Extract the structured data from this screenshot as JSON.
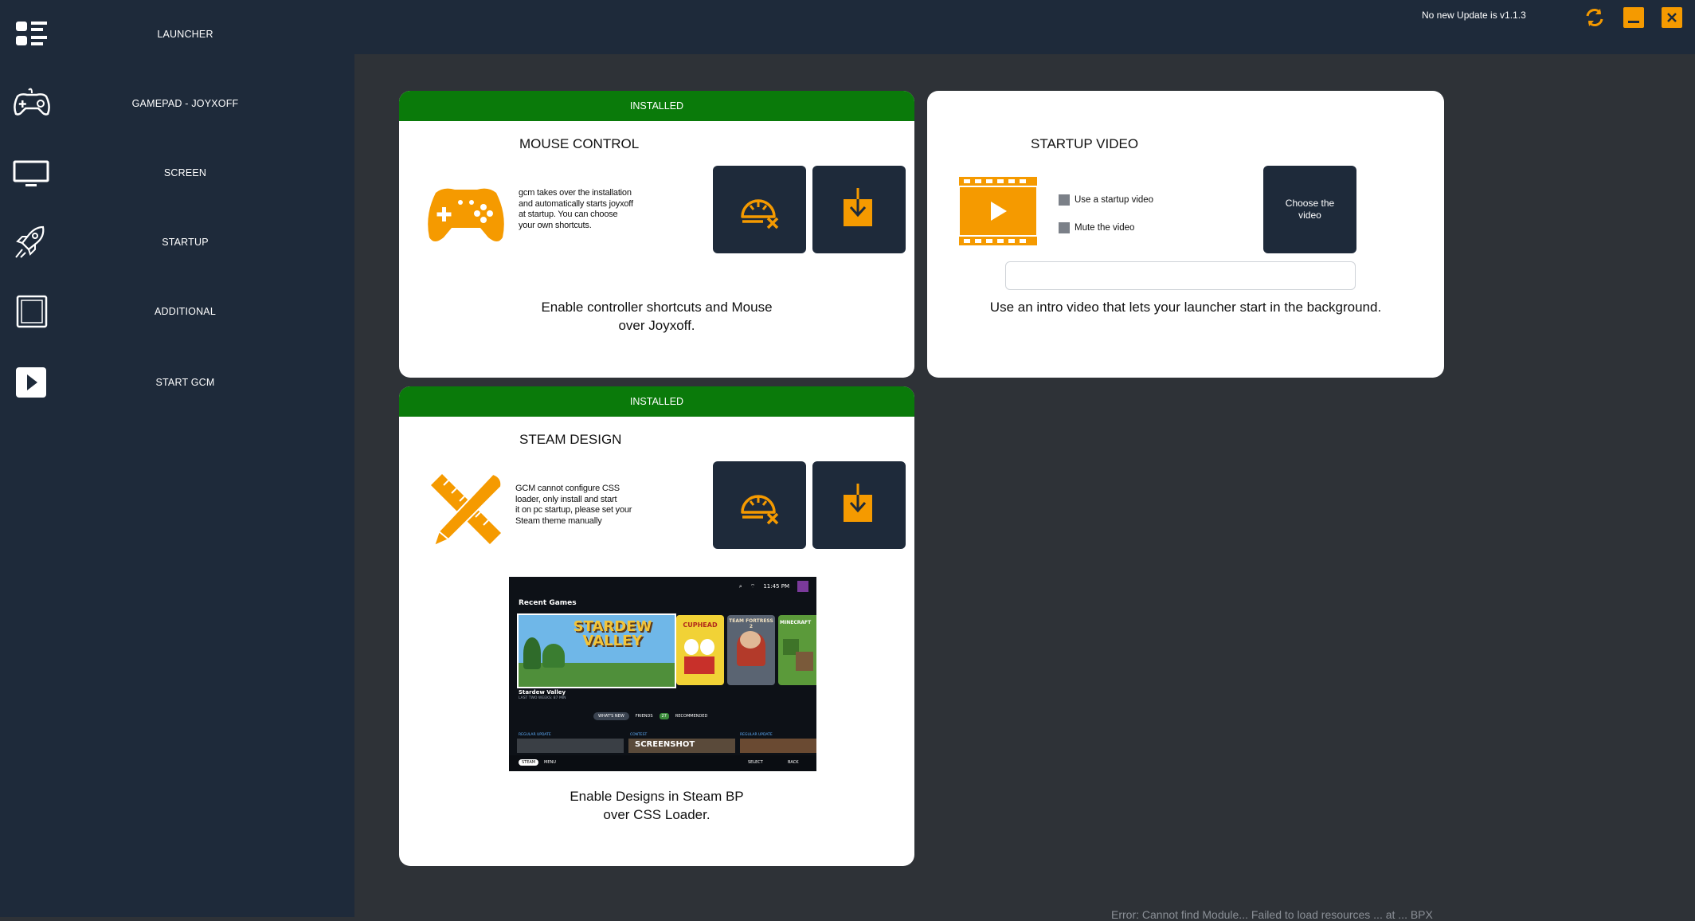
{
  "window": {
    "update_status": "No new Update is v1.1.3",
    "accent_color": "#f59a00",
    "sidebar_color": "#1e2a3a",
    "installed_color": "#0a7a0a"
  },
  "sidebar": {
    "items": [
      {
        "label": "LAUNCHER",
        "icon": "launcher-icon"
      },
      {
        "label": "GAMEPAD - JOYXOFF",
        "icon": "gamepad-icon"
      },
      {
        "label": "SCREEN",
        "icon": "monitor-icon"
      },
      {
        "label": "STARTUP",
        "icon": "rocket-icon"
      },
      {
        "label": "ADDITIONAL",
        "icon": "window-icon"
      },
      {
        "label": "START GCM",
        "icon": "play-icon"
      }
    ]
  },
  "cards": {
    "mouse_control": {
      "status": "INSTALLED",
      "title": "MOUSE CONTROL",
      "desc_lines": [
        "gcm takes over the installation",
        "and automatically starts joyxoff",
        "at startup. You can choose",
        "your own shortcuts."
      ],
      "footer_lines": [
        "Enable controller shortcuts and Mouse",
        "over Joyxoff."
      ]
    },
    "startup_video": {
      "title": "STARTUP VIDEO",
      "use_video_label": "Use a startup video",
      "mute_label": "Mute the video",
      "choose_lines": [
        "Choose the",
        "video"
      ],
      "path_value": "",
      "footer": "Use an intro video that lets your launcher start in the background."
    },
    "steam_design": {
      "status": "INSTALLED",
      "title": "STEAM DESIGN",
      "desc_lines": [
        "GCM cannot configure CSS",
        "loader, only install and start",
        "it on pc startup, please set your",
        "Steam theme manually"
      ],
      "footer_lines": [
        "Enable Designs in Steam BP",
        "over CSS Loader."
      ],
      "preview": {
        "time": "11:45 PM",
        "section": "Recent Games",
        "game1": "STARDEW VALLEY",
        "game2": "CUPHEAD",
        "game3": "TEAM FORTRESS 2",
        "game4": "MINECRAFT",
        "selected_title": "Stardew Valley",
        "selected_sub": "LAST TWO WEEKS: 87 MIN",
        "tabs": [
          "WHAT'S NEW",
          "FRIENDS",
          "RECOMMENDED"
        ],
        "friends_count": "27",
        "row_labels": [
          "REGULAR UPDATE",
          "CONTEST",
          "REGULAR UPDATE"
        ],
        "screenshot_label": "SCREENSHOT",
        "steam_label": "STEAM",
        "menu_label": "MENU",
        "select_label": "SELECT",
        "back_label": "BACK"
      }
    }
  },
  "bottom_text": "Error: Cannot find Module... Failed to load resources ... at ... BPX"
}
